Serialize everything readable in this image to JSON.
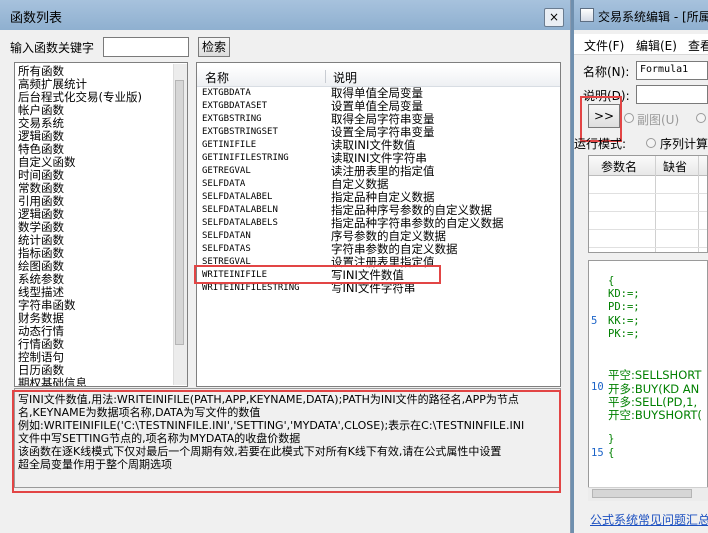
{
  "func_dialog": {
    "title": "函数列表",
    "close_label": "×",
    "keyword_label": "输入函数关键字",
    "keyword_value": "",
    "search_button": "检索",
    "categories": [
      "所有函数",
      "高频扩展统计",
      "后台程式化交易(专业版)",
      "帐户函数",
      "交易系统",
      "逻辑函数",
      "特色函数",
      "自定义函数",
      "时间函数",
      "常数函数",
      "引用函数",
      "逻辑函数",
      "数学函数",
      "统计函数",
      "指标函数",
      "绘图函数",
      "系统参数",
      "线型描述",
      "字符串函数",
      "财务数据",
      "动态行情",
      "行情函数",
      "控制语句",
      "日历函数",
      "期权基础信息"
    ],
    "columns": {
      "name": "名称",
      "desc": "说明"
    },
    "functions": [
      {
        "name": "EXTGBDATA",
        "desc": "取得单值全局变量"
      },
      {
        "name": "EXTGBDATASET",
        "desc": "设置单值全局变量"
      },
      {
        "name": "EXTGBSTRING",
        "desc": "取得全局字符串变量"
      },
      {
        "name": "EXTGBSTRINGSET",
        "desc": "设置全局字符串变量"
      },
      {
        "name": "GETINIFILE",
        "desc": "读取INI文件数值"
      },
      {
        "name": "GETINIFILESTRING",
        "desc": "读取INI文件字符串"
      },
      {
        "name": "GETREGVAL",
        "desc": "读注册表里的指定值"
      },
      {
        "name": "SELFDATA",
        "desc": "自定义数据"
      },
      {
        "name": "SELFDATALABEL",
        "desc": "指定品种自定义数据"
      },
      {
        "name": "SELFDATALABELN",
        "desc": "指定品种序号参数的自定义数据"
      },
      {
        "name": "SELFDATALABELS",
        "desc": "指定品种字符串参数的自定义数据"
      },
      {
        "name": "SELFDATAN",
        "desc": "序号参数的自定义数据"
      },
      {
        "name": "SELFDATAS",
        "desc": "字符串参数的自定义数据"
      },
      {
        "name": "SETREGVAL",
        "desc": "设置注册表里指定值"
      },
      {
        "name": "WRITEINIFILE",
        "desc": "写INI文件数值"
      },
      {
        "name": "WRITEINIFILESTRING",
        "desc": "写INI文件字符串"
      }
    ],
    "description": "写INI文件数值,用法:WRITEINIFILE(PATH,APP,KEYNAME,DATA);PATH为INI文件的路径名,APP为节点\n名,KEYNAME为数据项名称,DATA为写文件的数值\n例如:WRITEINIFILE('C:\\TESTNINFILE.INI','SETTING','MYDATA',CLOSE);表示在C:\\TESTNINFILE.INI\n文件中写SETTING节点的,项名称为MYDATA的收盘价数据\n该函数在逐K线模式下仅对最后一个周期有效,若要在此模式下对所有K线下有效,请在公式属性中设置\n超全局变量作用于整个周期选项"
  },
  "editor": {
    "title": "交易系统编辑 - [所属",
    "menus": [
      "文件(F)",
      "编辑(E)",
      "查看"
    ],
    "name_label": "名称(N):",
    "name_value": "Formula1",
    "desc_label": "说明(D):",
    "expand_button": ">>",
    "sub_label": "副图(U)",
    "mode_label": "运行模式:",
    "seq_label": "序列计算",
    "param_headers": [
      "参数名",
      "缺省"
    ],
    "code_lines": [
      {
        "ln": "",
        "text": "{"
      },
      {
        "ln": "",
        "text": "KD:=;"
      },
      {
        "ln": "",
        "text": "PD:=;"
      },
      {
        "ln": "5",
        "text": "KK:=;"
      },
      {
        "ln": "",
        "text": "PK:=;"
      },
      {
        "ln": "",
        "text": ""
      },
      {
        "ln": "",
        "text": ""
      },
      {
        "ln": "",
        "text": "平空:SELLSHORT"
      },
      {
        "ln": "10",
        "text": "开多:BUY(KD AN"
      },
      {
        "ln": "",
        "text": "平多:SELL(PD,1,"
      },
      {
        "ln": "",
        "text": "开空:BUYSHORT("
      },
      {
        "ln": "",
        "text": ""
      },
      {
        "ln": "",
        "text": "}"
      },
      {
        "ln": "15",
        "text": "{"
      }
    ],
    "bottom_link": "公式系统常见问题汇总"
  }
}
